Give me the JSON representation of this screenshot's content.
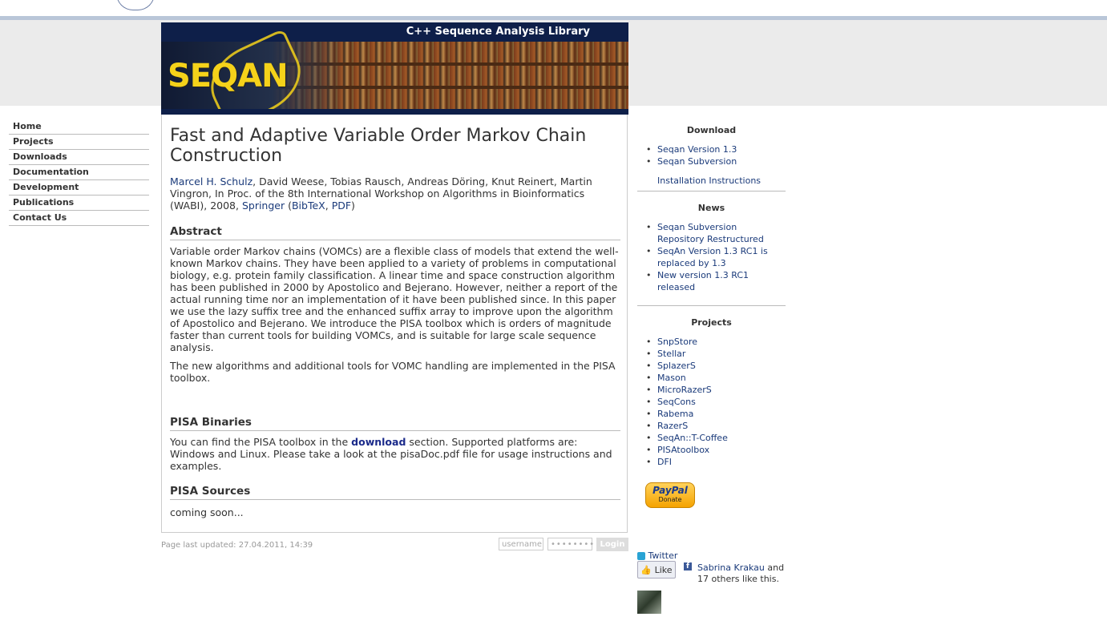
{
  "banner": {
    "title": "C++ Sequence Analysis Library",
    "logo": "SEQAN"
  },
  "nav": {
    "items": [
      {
        "label": "Home"
      },
      {
        "label": "Projects"
      },
      {
        "label": "Downloads"
      },
      {
        "label": "Documentation"
      },
      {
        "label": "Development"
      },
      {
        "label": "Publications"
      },
      {
        "label": "Contact Us"
      }
    ]
  },
  "article": {
    "title": "Fast and Adaptive Variable Order Markov Chain Construction",
    "author_link": "Marcel H. Schulz",
    "authors_rest": ", David Weese, Tobias Rausch, Andreas Döring, Knut Reinert, Martin Vingron, In Proc. of the 8th International Workshop on Algorithms in Bioinformatics (WABI), 2008, ",
    "publisher_link": "Springer",
    "bibtex_link": "BibTeX",
    "pdf_link": "PDF",
    "abstract_heading": "Abstract",
    "abstract_p1": "Variable order Markov chains (VOMCs) are a flexible class of models that extend the well-known Markov chains. They have been applied to a variety of problems in computational biology, e.g. protein family classification. A linear time and space construction algorithm has been published in 2000 by Apostolico and Bejerano. However, neither a report of the actual running time nor an implementation of it have been published since. In this paper we use the lazy suffix tree and the enhanced suffix array to improve upon the algorithm of Apostolico and Bejerano. We introduce the PISA toolbox which is orders of magnitude faster than current tools for building VOMCs, and is suitable for large scale sequence analysis.",
    "abstract_p2": "The new algorithms and additional tools for VOMC handling are implemented in the PISA toolbox.",
    "binaries_heading": "PISA Binaries",
    "binaries_pre": "You can find the PISA toolbox in the ",
    "binaries_link": "download",
    "binaries_post": " section. Supported platforms are: Windows and Linux. Please take a look at the pisaDoc.pdf file for usage instructions and examples.",
    "sources_heading": "PISA Sources",
    "sources_text": "coming soon..."
  },
  "footer": {
    "updated": "Page last updated: 27.04.2011, 14:39",
    "username_placeholder": "username",
    "password_placeholder": "••••••••",
    "login_label": "Login"
  },
  "sidebar": {
    "download_heading": "Download",
    "download_items": [
      {
        "label": "Seqan Version 1.3"
      },
      {
        "label": "Seqan Subversion"
      }
    ],
    "install_link": "Installation Instructions",
    "news_heading": "News",
    "news_items": [
      {
        "label": "Seqan Subversion Repository Restructured"
      },
      {
        "label": "SeqAn Version 1.3 RC1 is replaced by 1.3"
      },
      {
        "label": "New version 1.3 RC1 released"
      }
    ],
    "projects_heading": "Projects",
    "project_items": [
      {
        "label": "SnpStore"
      },
      {
        "label": "Stellar"
      },
      {
        "label": "SplazerS"
      },
      {
        "label": "Mason"
      },
      {
        "label": "MicroRazerS"
      },
      {
        "label": "SeqCons"
      },
      {
        "label": "Rabema"
      },
      {
        "label": "RazerS"
      },
      {
        "label": "SeqAn::T-Coffee"
      },
      {
        "label": "PISAtoolbox"
      },
      {
        "label": "DFI"
      }
    ],
    "paypal_label": "PayPal",
    "paypal_donate": "Donate",
    "twitter_label": "Twitter",
    "like_label": "Like",
    "like_name": "Sabrina Krakau",
    "like_rest": " and 17 others like this."
  }
}
